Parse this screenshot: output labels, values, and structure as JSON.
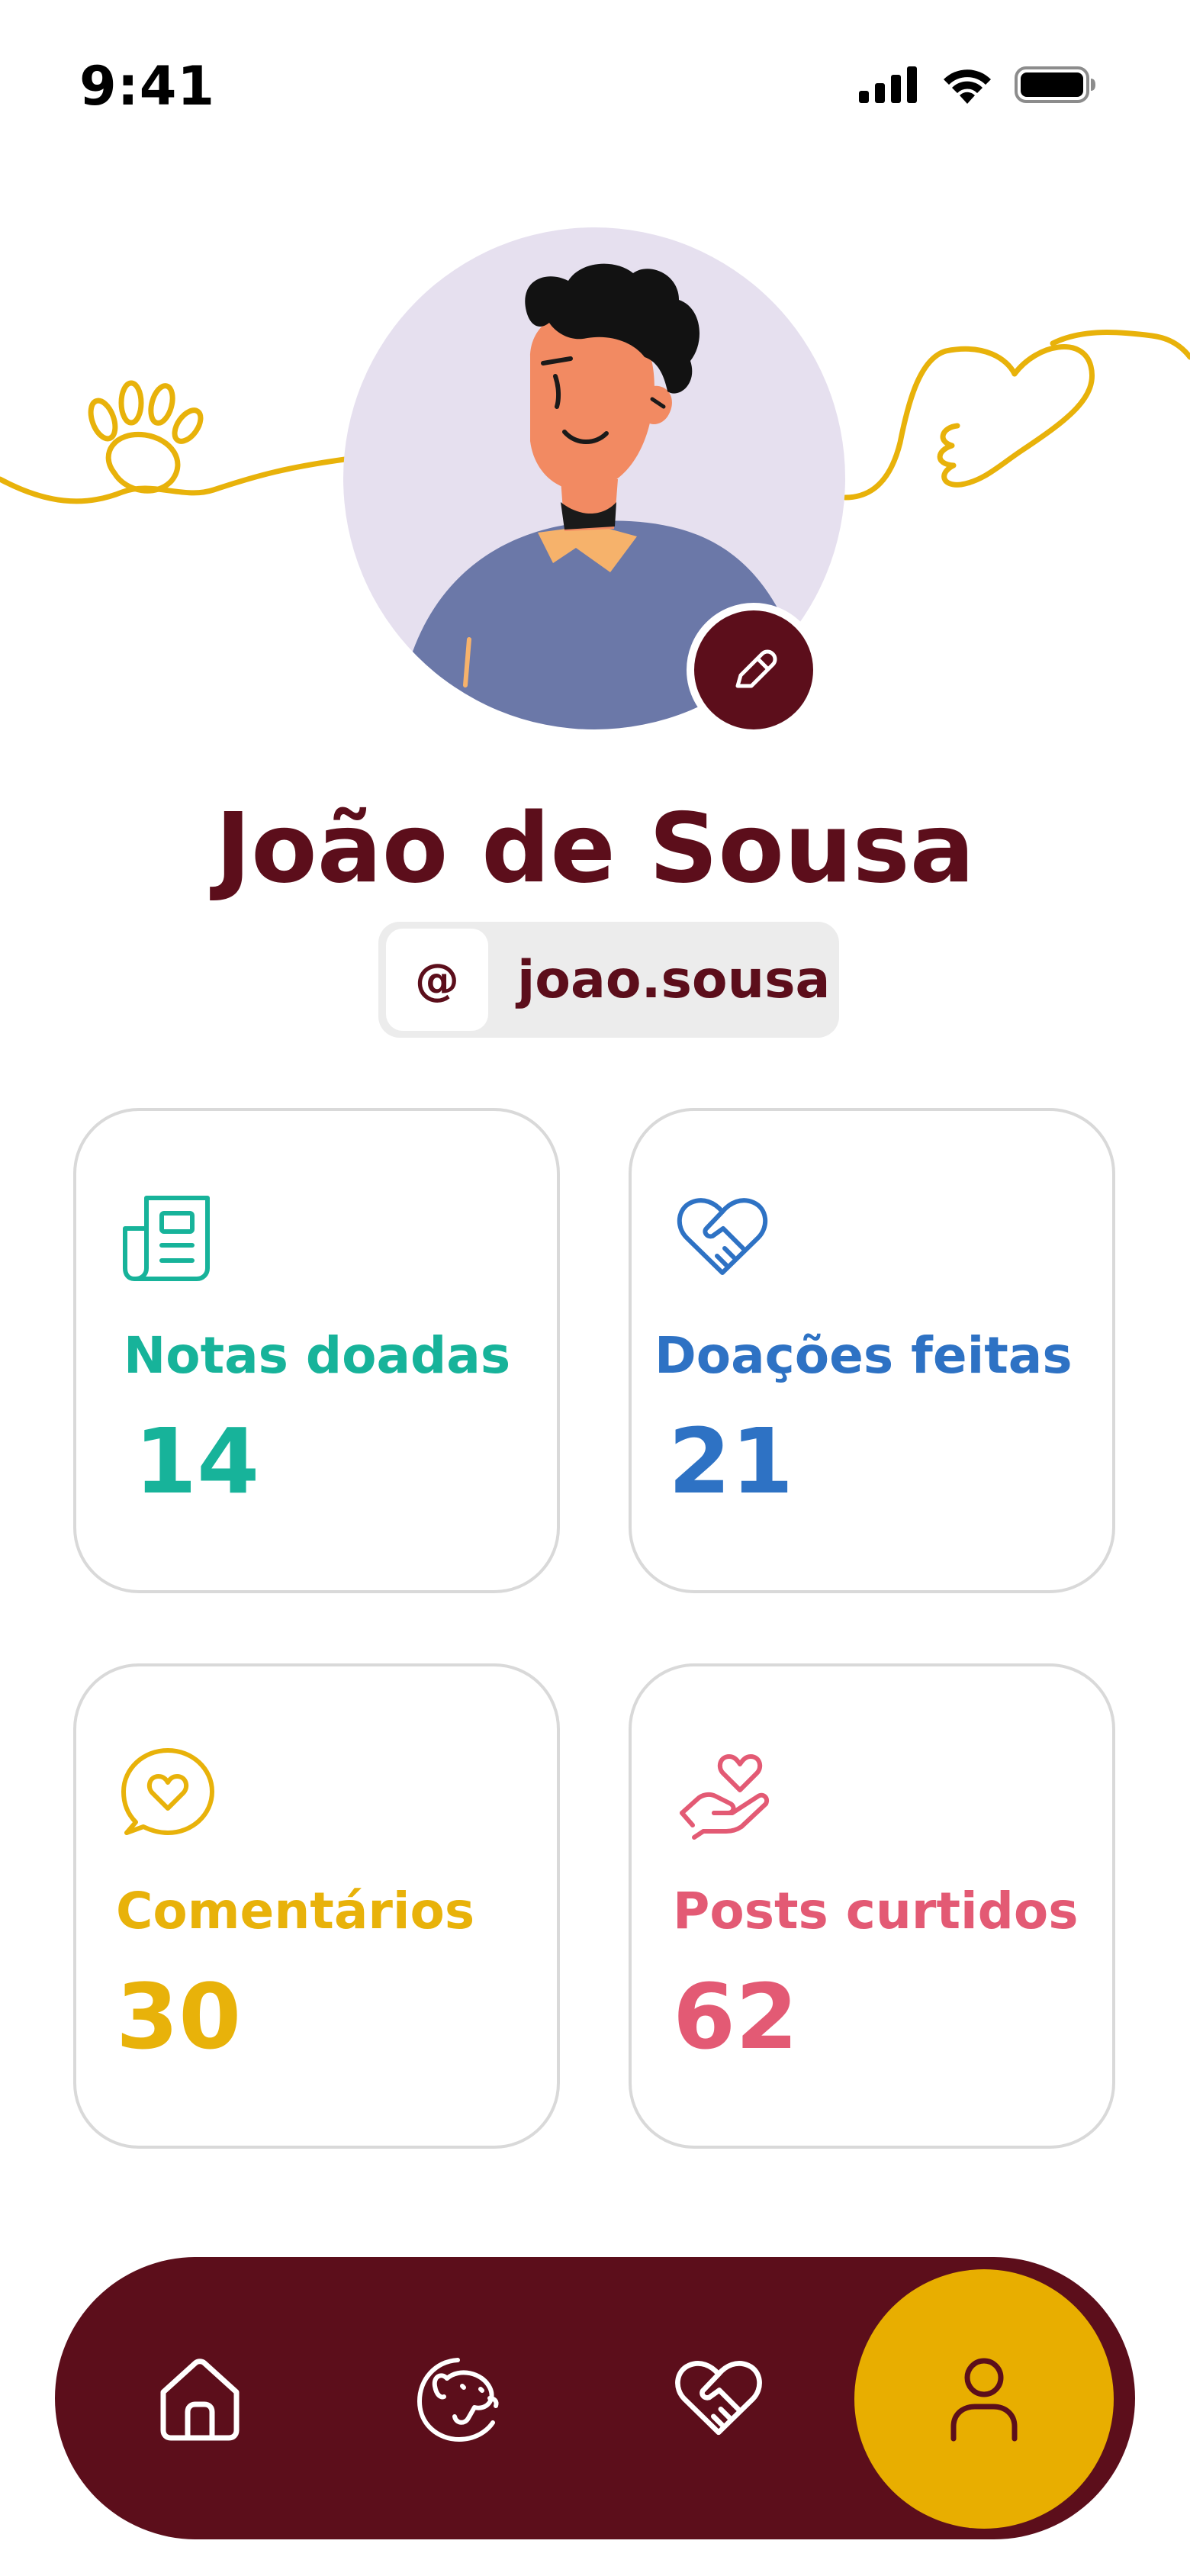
{
  "status_bar": {
    "time": "9:41"
  },
  "profile": {
    "name": "João de Sousa",
    "at_symbol": "@",
    "username": "joao.sousa"
  },
  "stats": [
    {
      "label": "Notas doadas",
      "value": "14",
      "icon": "receipt-icon",
      "color": "#17b39a"
    },
    {
      "label": "Doações feitas",
      "value": "21",
      "icon": "heart-handshake-icon",
      "color": "#2e72c4"
    },
    {
      "label": "Comentários",
      "value": "30",
      "icon": "heart-chat-icon",
      "color": "#e8b20a"
    },
    {
      "label": "Posts curtidos",
      "value": "62",
      "icon": "hand-heart-icon",
      "color": "#e35a74"
    }
  ],
  "nav": {
    "items": [
      "home-icon",
      "pet-icon",
      "heart-handshake-icon",
      "user-icon"
    ],
    "active": "user-icon"
  },
  "colors": {
    "primary": "#5c0e1b",
    "accent": "#e8ae00",
    "avatar_bg": "#e6e0ef"
  }
}
